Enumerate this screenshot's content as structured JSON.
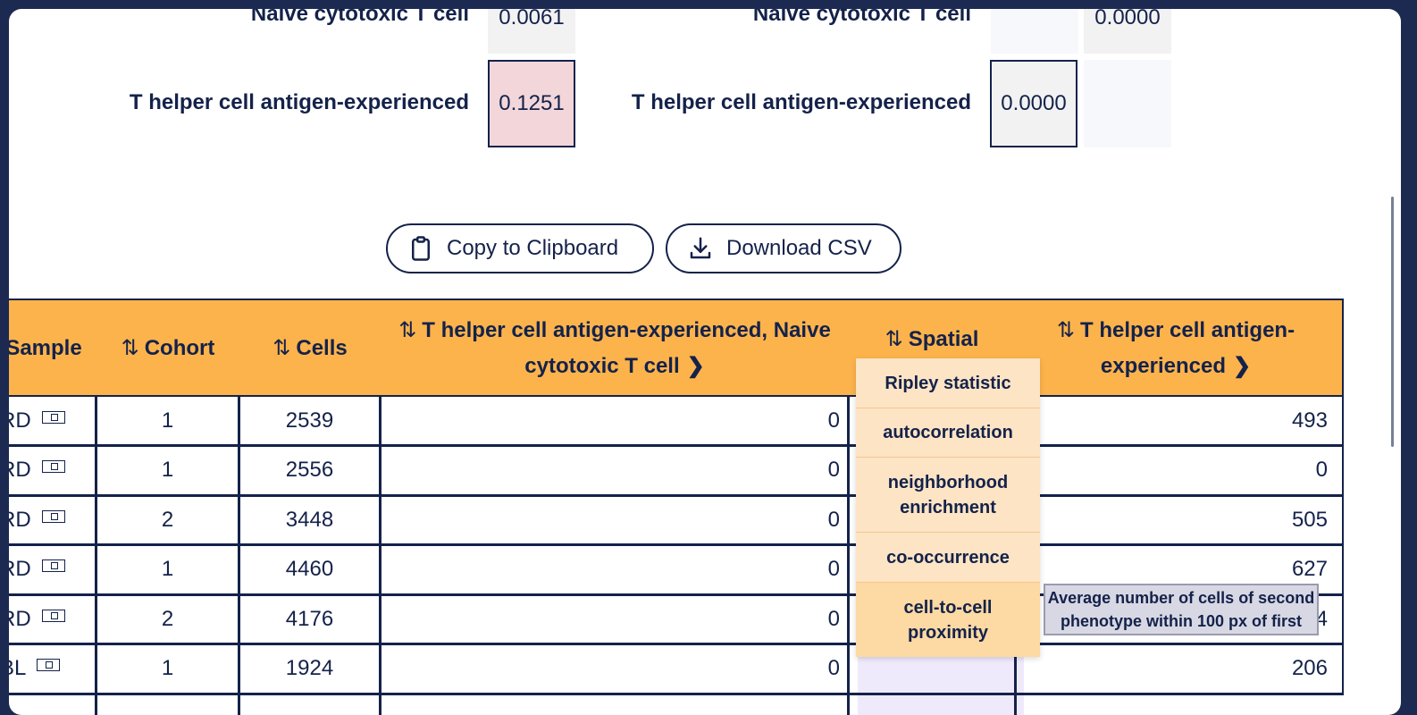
{
  "matrix": {
    "row1_label_left": "Naive cytotoxic T cell",
    "row1_value_left": "0.0061",
    "row1_label_right": "Naive cytotoxic T cell",
    "row1_value_right": "0.0000",
    "row2_label_left": "T helper cell antigen-experienced",
    "row2_value_left": "0.1251",
    "row2_label_right": "T helper cell antigen-experienced",
    "row2_value_right": "0.0000"
  },
  "buttons": {
    "copy_label": "Copy to Clipboard",
    "download_label": "Download CSV"
  },
  "table": {
    "headers": {
      "sample": "Sample",
      "cohort": "Cohort",
      "cells": "Cells",
      "pair": "T helper cell antigen-experienced, Naive cytotoxic T cell",
      "spatial": "Spatial Metrics",
      "thelper": "T helper cell antigen-experienced"
    },
    "sort_icon": "⇅",
    "rows": [
      {
        "sample": "RD",
        "cohort": "1",
        "cells": "2539",
        "pair": "0",
        "thelper": "493"
      },
      {
        "sample": "RD",
        "cohort": "1",
        "cells": "2556",
        "pair": "0",
        "thelper": "0"
      },
      {
        "sample": "RD",
        "cohort": "2",
        "cells": "3448",
        "pair": "0",
        "thelper": "505"
      },
      {
        "sample": "RD",
        "cohort": "1",
        "cells": "4460",
        "pair": "0",
        "thelper": "627"
      },
      {
        "sample": "RD",
        "cohort": "2",
        "cells": "4176",
        "pair": "0",
        "thelper": "504"
      },
      {
        "sample": "BL",
        "cohort": "1",
        "cells": "1924",
        "pair": "0",
        "thelper": "206"
      }
    ]
  },
  "spatial_menu": {
    "items": [
      "Ripley statistic",
      "autocorrelation",
      "neighborhood enrichment",
      "co-occurrence",
      "cell-to-cell proximity"
    ]
  },
  "tooltip": "Average number of cells of second phenotype within 100 px of first",
  "colors": {
    "navy": "#14224a",
    "header_orange": "#fdb34c",
    "highlight_pink": "#f2d6da",
    "menu_bg": "#fde4c4",
    "spatial_col": "#efeafb"
  }
}
